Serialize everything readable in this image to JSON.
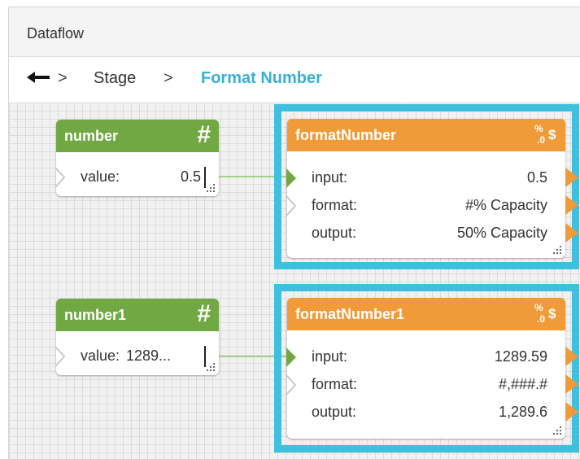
{
  "window": {
    "title": "Dataflow"
  },
  "breadcrumb": {
    "sep1": ">",
    "stage": "Stage",
    "sep2": ">",
    "current": "Format Number"
  },
  "colors": {
    "green_header": "#72a844",
    "orange_header": "#f09a38",
    "selection": "#3ec0de",
    "breadcrumb_active": "#3aafd0"
  },
  "nodes": {
    "number": {
      "title": "number",
      "icon": "hash-icon",
      "value_label": "value:",
      "value": "0.5"
    },
    "number1": {
      "title": "number1",
      "icon": "hash-icon",
      "value_label": "value:",
      "value": "1289..."
    },
    "formatNumber": {
      "title": "formatNumber",
      "icon": "percent-dollar-icon",
      "rows": [
        {
          "label": "input:",
          "value": "0.5"
        },
        {
          "label": "format:",
          "value": "#% Capacity"
        },
        {
          "label": "output:",
          "value": "50% Capacity"
        }
      ]
    },
    "formatNumber1": {
      "title": "formatNumber1",
      "icon": "percent-dollar-icon",
      "rows": [
        {
          "label": "input:",
          "value": "1289.59"
        },
        {
          "label": "format:",
          "value": "#,###.#"
        },
        {
          "label": "output:",
          "value": "1,289.6"
        }
      ]
    }
  }
}
